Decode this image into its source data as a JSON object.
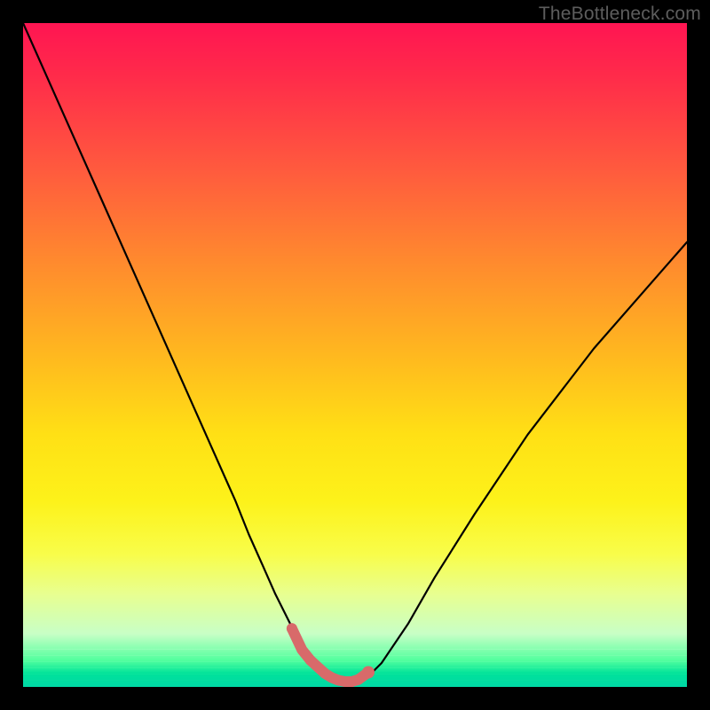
{
  "watermark": "TheBottleneck.com",
  "colors": {
    "curve": "#000000",
    "marker": "#d86a6a",
    "marker_stroke": "#c85858"
  },
  "chart_data": {
    "type": "line",
    "title": "",
    "xlabel": "",
    "ylabel": "",
    "xlim": [
      0,
      100
    ],
    "ylim": [
      0,
      100
    ],
    "series": [
      {
        "name": "bottleneck-curve",
        "x": [
          0,
          4,
          8,
          12,
          16,
          20,
          24,
          28,
          32,
          34,
          36,
          38,
          40,
          41,
          42,
          43,
          44,
          45,
          46,
          47,
          48,
          49,
          50,
          52,
          54,
          58,
          62,
          68,
          76,
          86,
          100
        ],
        "y": [
          100,
          91,
          82,
          73,
          64,
          55,
          46,
          37,
          28,
          23,
          18.5,
          14,
          10,
          8,
          6.2,
          4.8,
          3.6,
          2.6,
          1.8,
          1.2,
          0.8,
          0.8,
          1.0,
          1.6,
          3.6,
          9.5,
          16.5,
          26,
          38,
          51,
          67
        ]
      }
    ],
    "markers": {
      "name": "optimal-range",
      "x": [
        40.5,
        42,
        43.3,
        44.5,
        45.5,
        46.5,
        47.5,
        48.5,
        49.5,
        50.5,
        52
      ],
      "y": [
        8.8,
        5.6,
        4.0,
        2.9,
        2.0,
        1.4,
        1.0,
        0.8,
        0.8,
        1.1,
        2.2
      ],
      "radius": [
        6,
        5,
        6,
        5,
        5,
        5,
        5,
        5,
        6,
        6,
        7
      ]
    }
  }
}
